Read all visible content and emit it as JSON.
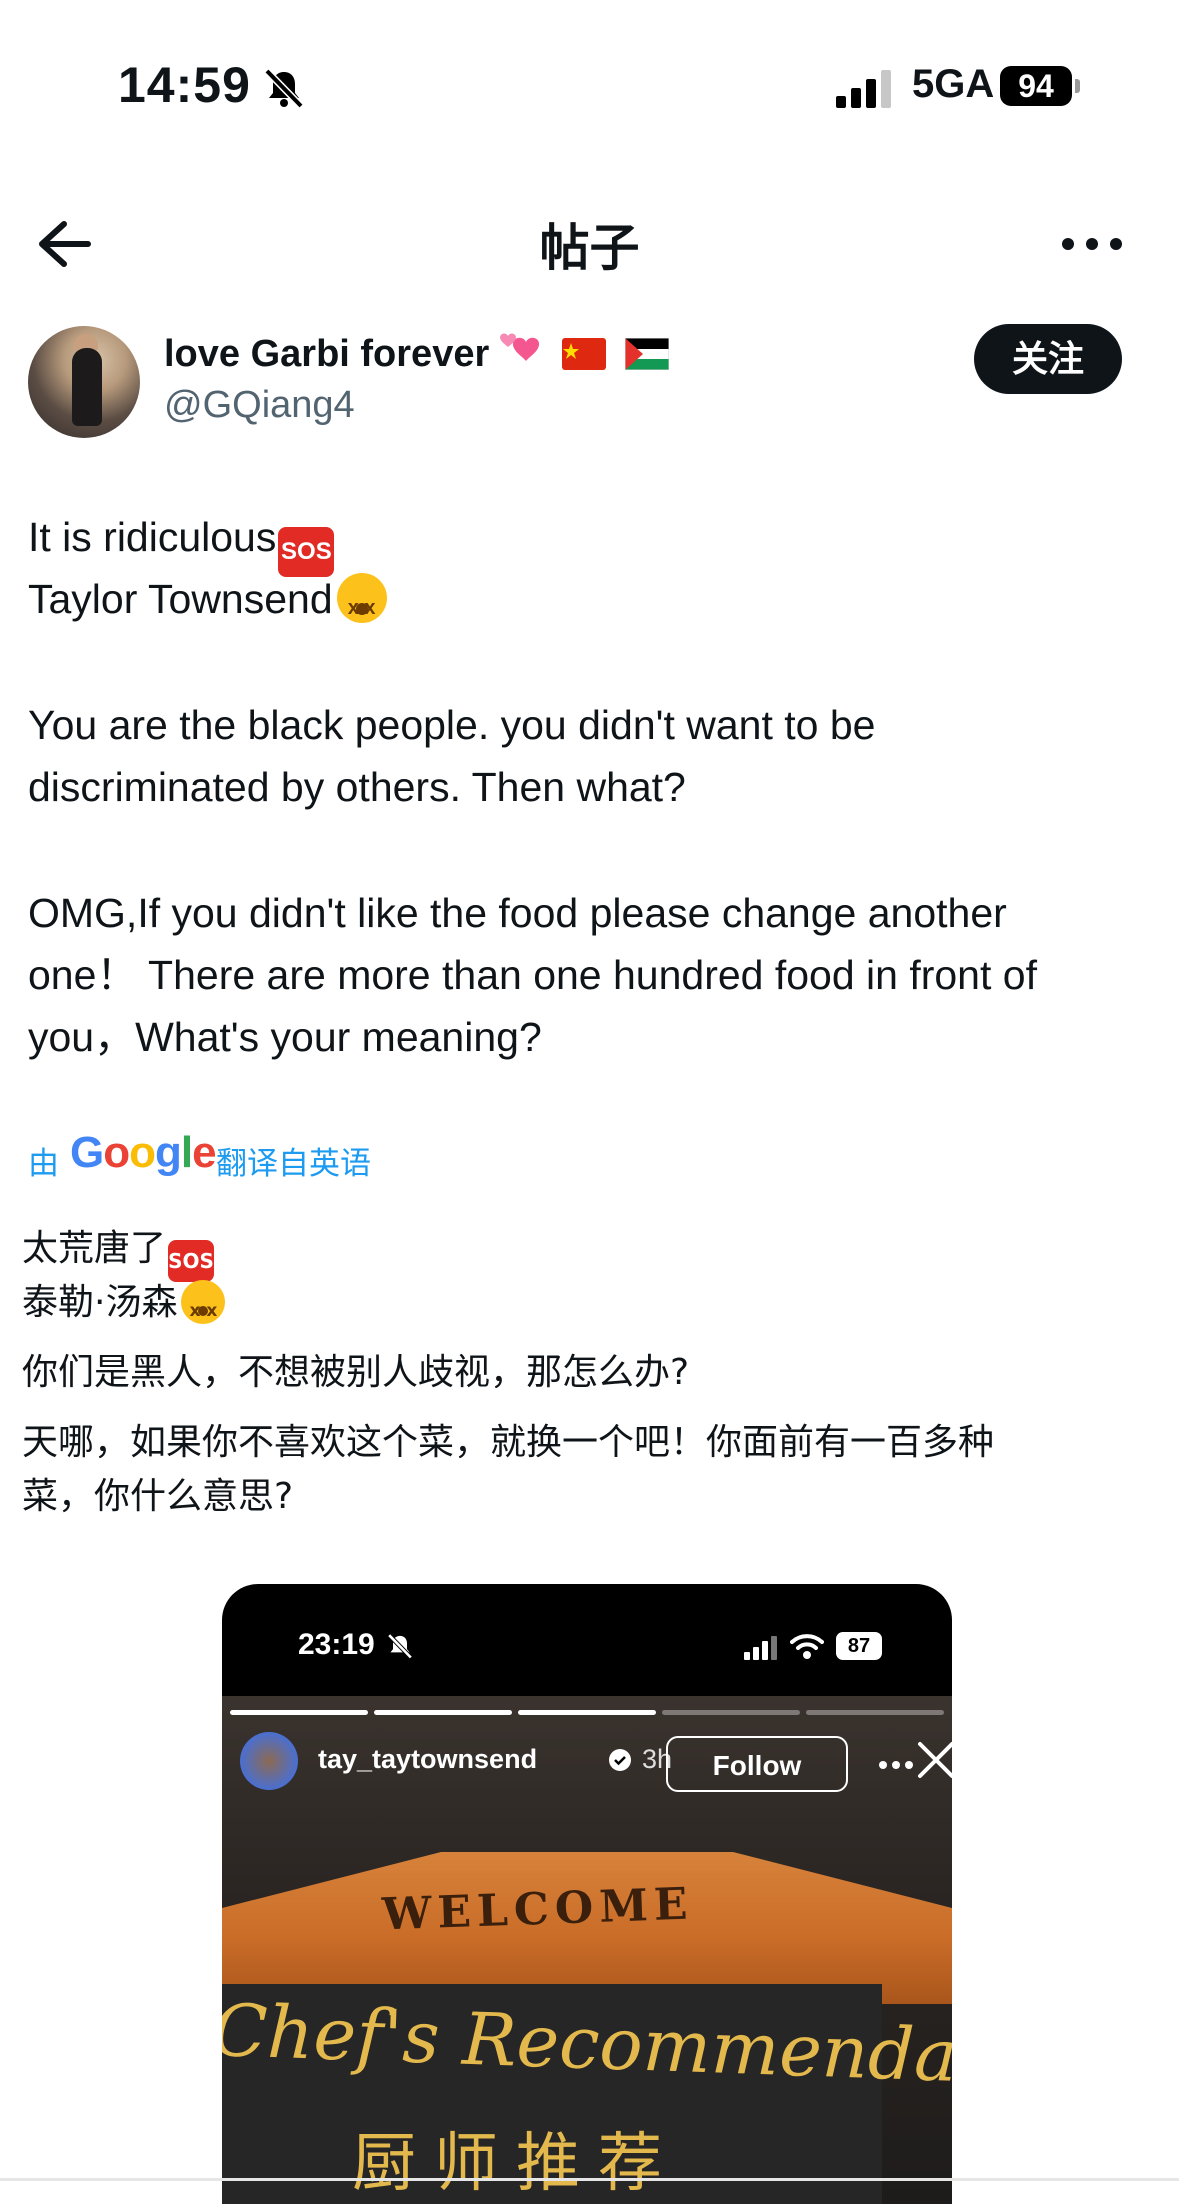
{
  "status_bar": {
    "time": "14:59",
    "network": "5GA",
    "battery": "94"
  },
  "nav": {
    "title": "帖子"
  },
  "author": {
    "display_name": "love Garbi forever",
    "handle": "@GQiang4",
    "follow_label": "关注"
  },
  "post": {
    "lines": [
      "It is ridiculous",
      "Taylor Townsend",
      "You are the black people. you didn't want to be",
      "discriminated by others. Then what?",
      "OMG,If you didn't like the food please change another",
      "one！ There are more than one hundred food in front of",
      "you，What's your meaning?"
    ]
  },
  "translation": {
    "by": "由",
    "google": [
      "G",
      "o",
      "o",
      "g",
      "l",
      "e"
    ],
    "google_colors": [
      "#4285F4",
      "#EA4335",
      "#FBBC05",
      "#4285F4",
      "#34A853",
      "#EA4335"
    ],
    "from": "翻译自英语",
    "lines": [
      "太荒唐了",
      "泰勒·汤森",
      "你们是黑人，不想被别人歧视，那怎么办?",
      "天哪，如果你不喜欢这个菜，就换一个吧！你面前有一百多种",
      "菜，你什么意思?"
    ]
  },
  "emoji": {
    "sos": "SOS"
  },
  "media": {
    "time": "23:19",
    "battery": "87",
    "username": "tay_taytownsend",
    "age": "3h",
    "follow_label": "Follow",
    "sign_welcome": "WELCOME",
    "sign_title": "Chef's Recommendations",
    "sign_zh": "厨师推荐"
  }
}
